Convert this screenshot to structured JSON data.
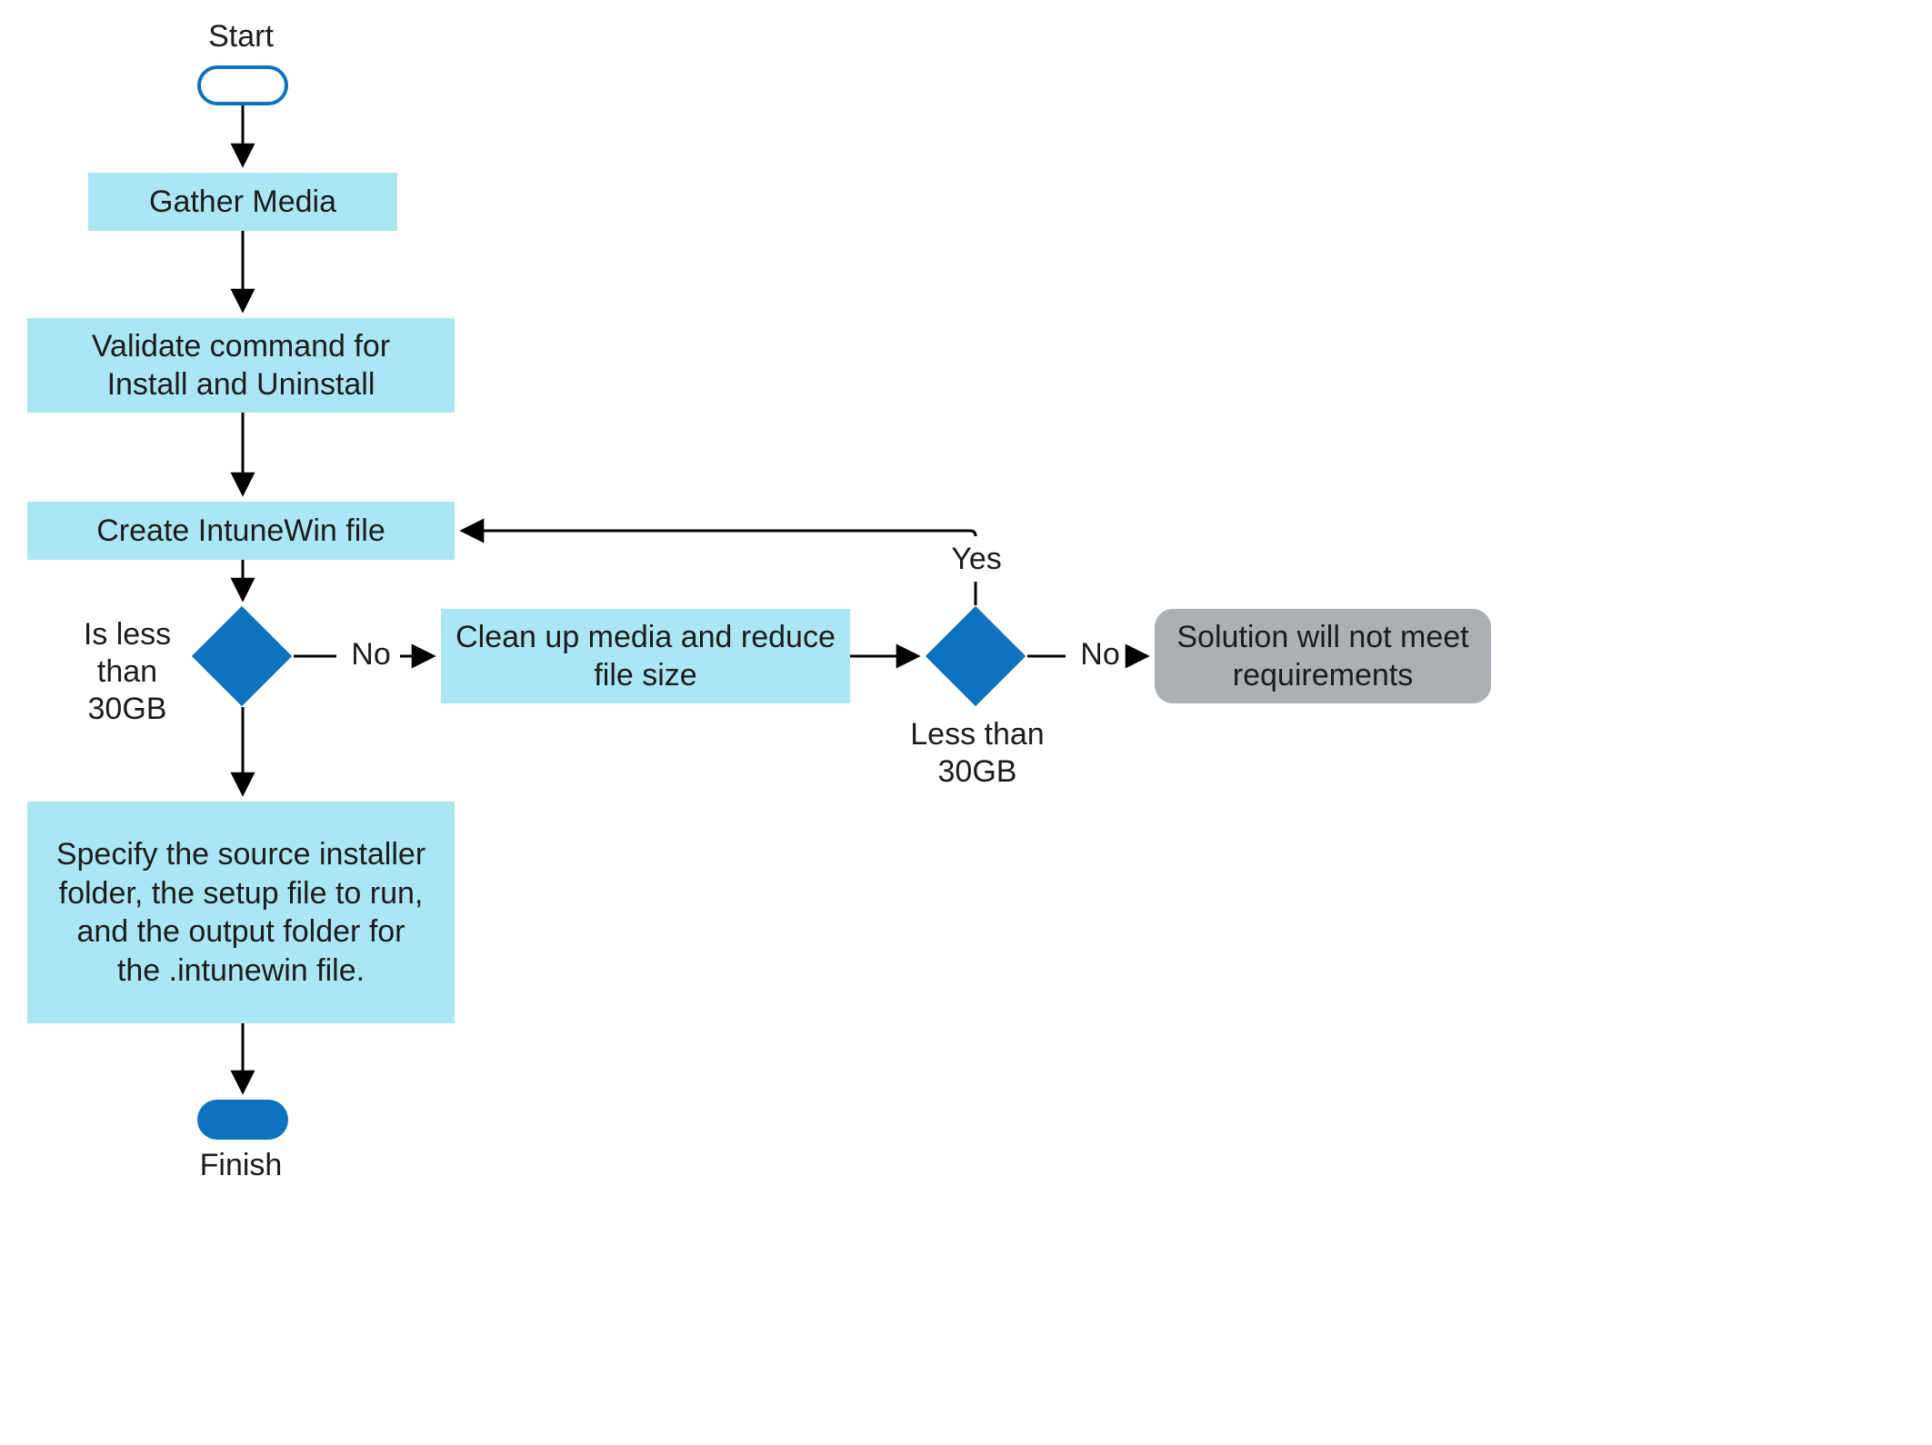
{
  "start_label": "Start",
  "finish_label": "Finish",
  "nodes": {
    "gather_media": "Gather Media",
    "validate": "Validate command for\nInstall and Uninstall",
    "create_intunewin": "Create IntuneWin file",
    "specify": "Specify the source installer folder, the setup file to run, and the output folder for the .intunewin file.",
    "cleanup": "Clean up media and reduce file size",
    "solution": "Solution will not meet requirements"
  },
  "decisions": {
    "d1_label": "Is less\nthan 30GB",
    "d2_label": "Less than\n30GB"
  },
  "edges": {
    "no": "No",
    "yes": "Yes"
  },
  "colors": {
    "process_fill": "#abe6f4",
    "decision_fill": "#0d73c1",
    "terminator_fill": "#acb0b4",
    "line": "#000000"
  }
}
